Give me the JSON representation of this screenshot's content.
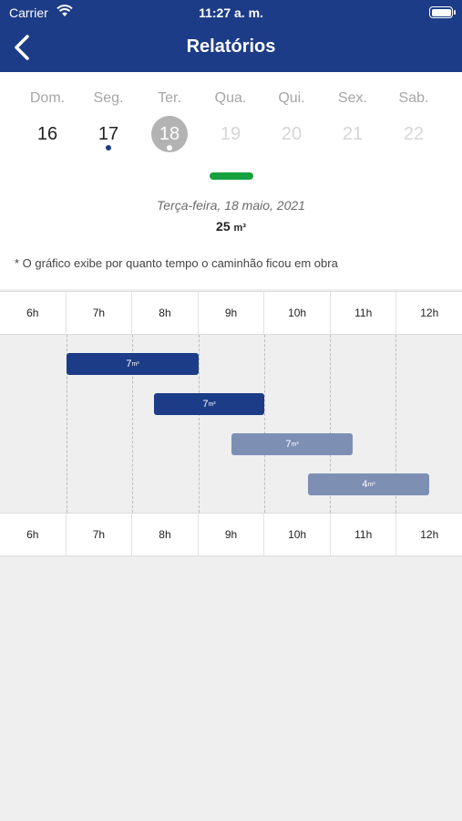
{
  "status": {
    "carrier": "Carrier",
    "time": "11:27 a. m."
  },
  "header": {
    "title": "Relatórios"
  },
  "week": [
    {
      "name": "Dom.",
      "num": "16"
    },
    {
      "name": "Seg.",
      "num": "17"
    },
    {
      "name": "Ter.",
      "num": "18"
    },
    {
      "name": "Qua.",
      "num": "19"
    },
    {
      "name": "Qui.",
      "num": "20"
    },
    {
      "name": "Sex.",
      "num": "21"
    },
    {
      "name": "Sab.",
      "num": "22"
    }
  ],
  "info": {
    "date": "Terça-feira, 18 maio, 2021",
    "volume": "25",
    "volume_unit": "m³",
    "note": "* O gráfico exibe por quanto tempo o caminhão ficou em obra"
  },
  "hours": [
    "6h",
    "7h",
    "8h",
    "9h",
    "10h",
    "11h",
    "12h"
  ],
  "bars": [
    {
      "value": "7",
      "unit": "m³"
    },
    {
      "value": "7",
      "unit": "m³"
    },
    {
      "value": "7",
      "unit": "m³"
    },
    {
      "value": "4",
      "unit": "m³"
    }
  ],
  "colors": {
    "primary": "#1d3c87",
    "pending": "#7e8fb4",
    "indicator": "#17a23f"
  }
}
